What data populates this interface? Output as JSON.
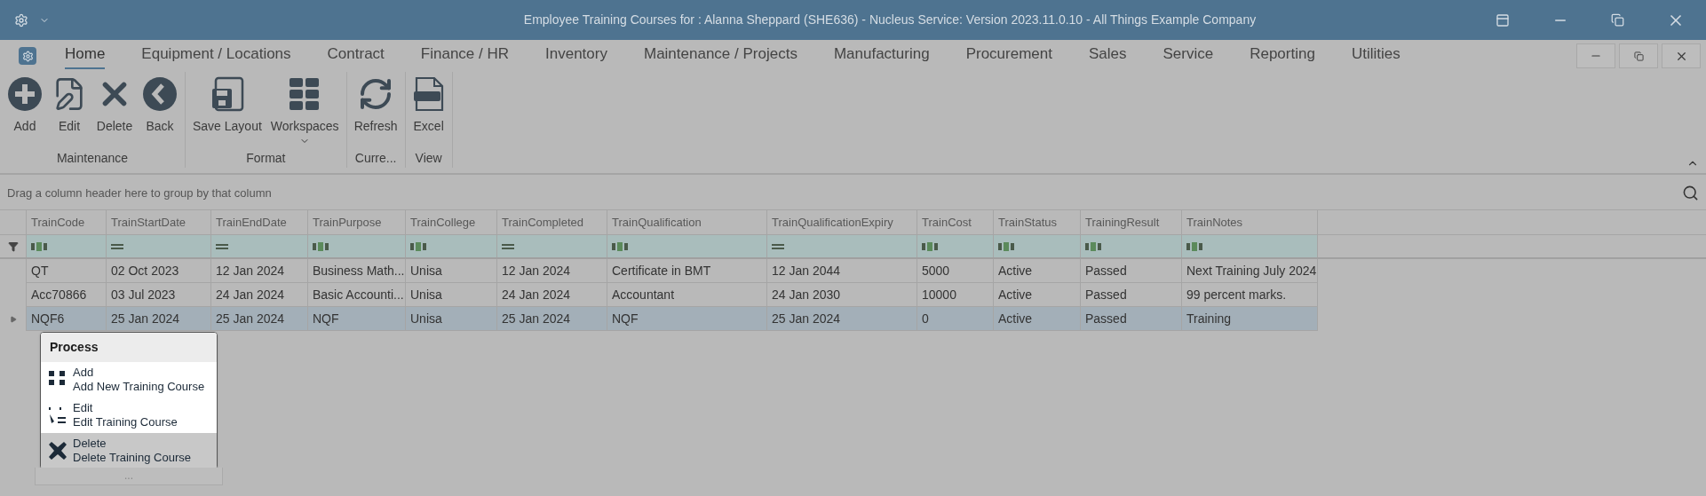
{
  "window": {
    "title": "Employee Training Courses for : Alanna Sheppard (SHE636) - Nucleus Service: Version 2023.11.0.10 - All Things Example Company"
  },
  "tabs": [
    {
      "label": "Home",
      "selected": true
    },
    {
      "label": "Equipment / Locations",
      "selected": false
    },
    {
      "label": "Contract",
      "selected": false
    },
    {
      "label": "Finance / HR",
      "selected": false
    },
    {
      "label": "Inventory",
      "selected": false
    },
    {
      "label": "Maintenance / Projects",
      "selected": false
    },
    {
      "label": "Manufacturing",
      "selected": false
    },
    {
      "label": "Procurement",
      "selected": false
    },
    {
      "label": "Sales",
      "selected": false
    },
    {
      "label": "Service",
      "selected": false
    },
    {
      "label": "Reporting",
      "selected": false
    },
    {
      "label": "Utilities",
      "selected": false
    }
  ],
  "ribbon_groups": [
    {
      "label": "Maintenance",
      "buttons": [
        {
          "label": "Add",
          "kind": "add"
        },
        {
          "label": "Edit",
          "kind": "edit"
        },
        {
          "label": "Delete",
          "kind": "delete"
        },
        {
          "label": "Back",
          "kind": "back"
        }
      ]
    },
    {
      "label": "Format",
      "buttons": [
        {
          "label": "Save Layout",
          "kind": "save"
        },
        {
          "label": "Workspaces",
          "kind": "workspaces"
        }
      ]
    },
    {
      "label": "Curre...",
      "buttons": [
        {
          "label": "Refresh",
          "kind": "refresh"
        }
      ]
    },
    {
      "label": "View",
      "buttons": [
        {
          "label": "Excel",
          "kind": "excel"
        }
      ]
    }
  ],
  "group_panel": {
    "hint": "Drag a column header here to group by that column"
  },
  "table": {
    "columns": [
      {
        "label": "TrainCode",
        "kind": "text"
      },
      {
        "label": "TrainStartDate",
        "kind": "equals"
      },
      {
        "label": "TrainEndDate",
        "kind": "equals"
      },
      {
        "label": "TrainPurpose",
        "kind": "text"
      },
      {
        "label": "TrainCollege",
        "kind": "text"
      },
      {
        "label": "TrainCompleted",
        "kind": "equals"
      },
      {
        "label": "TrainQualification",
        "kind": "text"
      },
      {
        "label": "TrainQualificationExpiry",
        "kind": "equals"
      },
      {
        "label": "TrainCost",
        "kind": "text"
      },
      {
        "label": "TrainStatus",
        "kind": "text"
      },
      {
        "label": "TrainingResult",
        "kind": "text"
      },
      {
        "label": "TrainNotes",
        "kind": "text"
      }
    ],
    "rows": [
      {
        "selected": false,
        "cells": [
          "QT",
          "02 Oct 2023",
          "12 Jan 2024",
          "Business Math...",
          "Unisa",
          "12 Jan 2024",
          "Certificate in BMT",
          "12 Jan 2044",
          "5000",
          "Active",
          "Passed",
          "Next Training July 2024"
        ]
      },
      {
        "selected": false,
        "cells": [
          "Acc70866",
          "03 Jul 2023",
          "24 Jan 2024",
          "Basic Accounti...",
          "Unisa",
          "24 Jan 2024",
          "Accountant",
          "24 Jan 2030",
          "10000",
          "Active",
          "Passed",
          "99 percent marks."
        ]
      },
      {
        "selected": true,
        "cells": [
          "NQF6",
          "25 Jan 2024",
          "25 Jan 2024",
          "NQF",
          "Unisa",
          "25 Jan 2024",
          "NQF",
          "25 Jan 2024",
          "0",
          "Active",
          "Passed",
          "Training"
        ]
      }
    ]
  },
  "context_menu": {
    "title": "Process",
    "items": [
      {
        "kind": "add",
        "label": "Add",
        "description": "Add New Training Course",
        "selected": false
      },
      {
        "kind": "edit",
        "label": "Edit",
        "description": "Edit Training Course",
        "selected": false
      },
      {
        "kind": "delete",
        "label": "Delete",
        "description": "Delete Training Course",
        "selected": true
      }
    ],
    "more": "..."
  }
}
